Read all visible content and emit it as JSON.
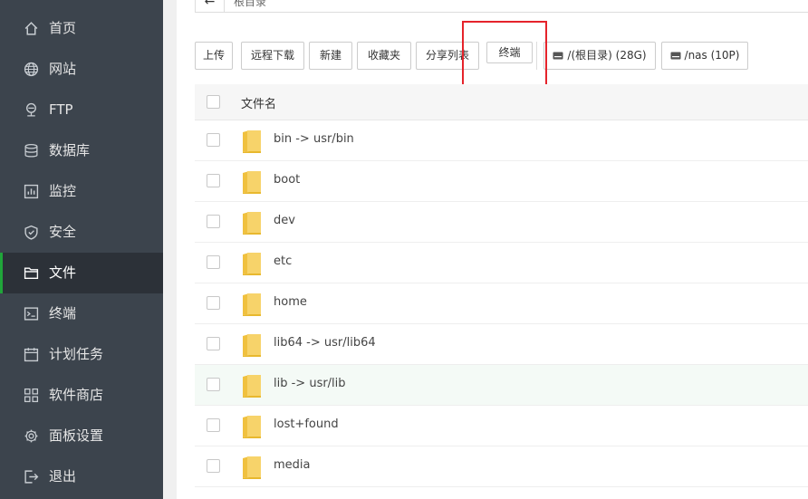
{
  "sidebar": {
    "items": [
      {
        "label": "首页",
        "icon": "home-icon"
      },
      {
        "label": "网站",
        "icon": "globe-icon"
      },
      {
        "label": "FTP",
        "icon": "ftp-icon"
      },
      {
        "label": "数据库",
        "icon": "database-icon"
      },
      {
        "label": "监控",
        "icon": "monitor-icon"
      },
      {
        "label": "安全",
        "icon": "shield-icon"
      },
      {
        "label": "文件",
        "icon": "folder-icon",
        "active": true
      },
      {
        "label": "终端",
        "icon": "terminal-icon"
      },
      {
        "label": "计划任务",
        "icon": "calendar-icon"
      },
      {
        "label": "软件商店",
        "icon": "grid-icon"
      },
      {
        "label": "面板设置",
        "icon": "gear-icon"
      },
      {
        "label": "退出",
        "icon": "logout-icon"
      }
    ]
  },
  "pathbar": {
    "path": "根目录"
  },
  "toolbar": {
    "upload": "上传",
    "remote_download": "远程下载",
    "new": "新建",
    "favorites": "收藏夹",
    "share_list": "分享列表",
    "terminal": "终端",
    "disk_root": "/(根目录) (28G)",
    "disk_nas": "/nas (10P)"
  },
  "table": {
    "header_name": "文件名",
    "rows": [
      {
        "name": "bin -> usr/bin"
      },
      {
        "name": "boot"
      },
      {
        "name": "dev"
      },
      {
        "name": "etc"
      },
      {
        "name": "home"
      },
      {
        "name": "lib64 -> usr/lib64"
      },
      {
        "name": "lib -> usr/lib",
        "hover": true
      },
      {
        "name": "lost+found"
      },
      {
        "name": "media"
      }
    ]
  },
  "colors": {
    "sidebar_bg": "#3c444d",
    "sidebar_active_bg": "#2c3138",
    "accent_green": "#20a53a",
    "highlight_red": "#e5232b",
    "folder_yellow": "#f7c94f"
  }
}
